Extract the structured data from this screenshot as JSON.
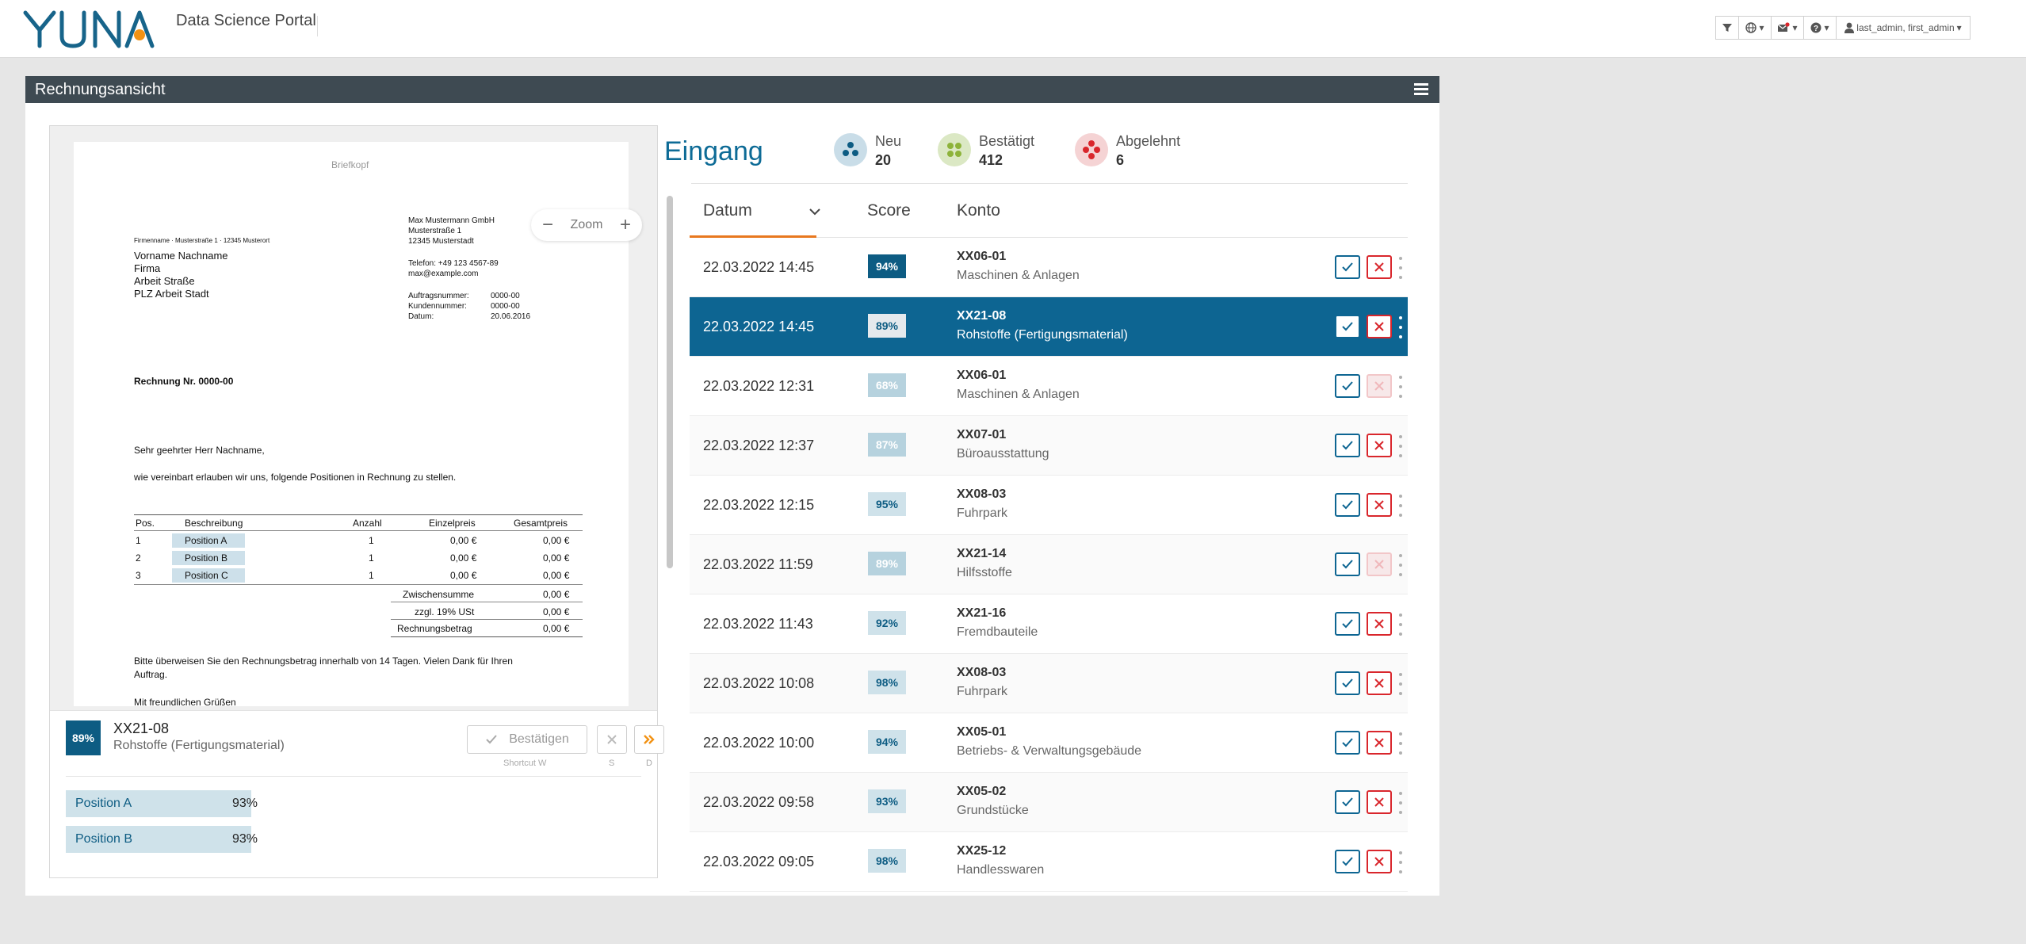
{
  "header": {
    "logo_text": "YUNA",
    "app_title": "Data Science Portal",
    "user_label": "last_admin, first_admin"
  },
  "panel": {
    "title": "Rechnungsansicht"
  },
  "viewer": {
    "zoom_label": "Zoom",
    "document": {
      "header_text": "Briefkopf",
      "sender_line": "Firmenname · Musterstraße 1 · 12345 Musterort",
      "recipient": [
        "Vorname Nachname",
        "Firma",
        "Arbeit Straße",
        "PLZ Arbeit Stadt"
      ],
      "company": [
        "Max Mustermann GmbH",
        "Musterstraße 1",
        "12345 Musterstadt"
      ],
      "contact": [
        "Telefon: +49 123 4567-89",
        "max@example.com"
      ],
      "meta_labels": [
        "Auftragsnummer:",
        "Kundennummer:",
        "Datum:"
      ],
      "meta_values": [
        "0000-00",
        "0000-00",
        "20.06.2016"
      ],
      "invoice_title": "Rechnung Nr. 0000-00",
      "salutation": "Sehr geehrter Herr Nachname,",
      "intro": "wie vereinbart erlauben wir uns, folgende Positionen in Rechnung zu stellen.",
      "table_headers": [
        "Pos.",
        "Beschreibung",
        "Anzahl",
        "Einzelpreis",
        "Gesamtpreis"
      ],
      "table_rows": [
        [
          "1",
          "Position A",
          "1",
          "0,00 €",
          "0,00 €"
        ],
        [
          "2",
          "Position B",
          "1",
          "0,00 €",
          "0,00 €"
        ],
        [
          "3",
          "Position C",
          "1",
          "0,00 €",
          "0,00 €"
        ]
      ],
      "totals": [
        [
          "Zwischensumme",
          "0,00 €"
        ],
        [
          "zzgl. 19% USt",
          "0,00 €"
        ],
        [
          "Rechnungsbetrag",
          "0,00 €"
        ]
      ],
      "closing": "Bitte überweisen Sie den Rechnungsbetrag innerhalb von 14 Tagen. Vielen Dank für Ihren",
      "closing2": "Auftrag.",
      "greeting": "Mit freundlichen Grüßen"
    }
  },
  "detail": {
    "score": "89%",
    "code": "XX21-08",
    "account": "Rohstoffe (Fertigungsmaterial)",
    "confirm_label": "Bestätigen",
    "shortcut_w": "Shortcut W",
    "shortcut_s": "S",
    "shortcut_d": "D",
    "positions": [
      {
        "label": "Position A",
        "value": "93%"
      },
      {
        "label": "Position B",
        "value": "93%"
      }
    ]
  },
  "inbox": {
    "title": "Eingang",
    "stats": [
      {
        "label": "Neu",
        "count": "20",
        "color": "#0d5c83"
      },
      {
        "label": "Bestätigt",
        "count": "412",
        "color": "#8db33a"
      },
      {
        "label": "Abgelehnt",
        "count": "6",
        "color": "#d9262c"
      }
    ],
    "columns": {
      "date": "Datum",
      "score": "Score",
      "account": "Konto"
    },
    "rows": [
      {
        "date": "22.03.2022 14:45",
        "score": "94%",
        "code": "XX06-01",
        "account": "Maschinen & Anlagen"
      },
      {
        "date": "22.03.2022 14:45",
        "score": "89%",
        "code": "XX21-08",
        "account": "Rohstoffe (Fertigungsmaterial)"
      },
      {
        "date": "22.03.2022 12:31",
        "score": "68%",
        "code": "XX06-01",
        "account": "Maschinen & Anlagen"
      },
      {
        "date": "22.03.2022 12:37",
        "score": "87%",
        "code": "XX07-01",
        "account": "Büroausstattung"
      },
      {
        "date": "22.03.2022 12:15",
        "score": "95%",
        "code": "XX08-03",
        "account": "Fuhrpark"
      },
      {
        "date": "22.03.2022 11:59",
        "score": "89%",
        "code": "XX21-14",
        "account": "Hilfsstoffe"
      },
      {
        "date": "22.03.2022 11:43",
        "score": "92%",
        "code": "XX21-16",
        "account": "Fremdbauteile"
      },
      {
        "date": "22.03.2022 10:08",
        "score": "98%",
        "code": "XX08-03",
        "account": "Fuhrpark"
      },
      {
        "date": "22.03.2022 10:00",
        "score": "94%",
        "code": "XX05-01",
        "account": "Betriebs- & Verwaltungsgebäude"
      },
      {
        "date": "22.03.2022 09:58",
        "score": "93%",
        "code": "XX05-02",
        "account": "Grundstücke"
      },
      {
        "date": "22.03.2022 09:05",
        "score": "98%",
        "code": "XX25-12",
        "account": "Handlesswaren"
      }
    ]
  }
}
